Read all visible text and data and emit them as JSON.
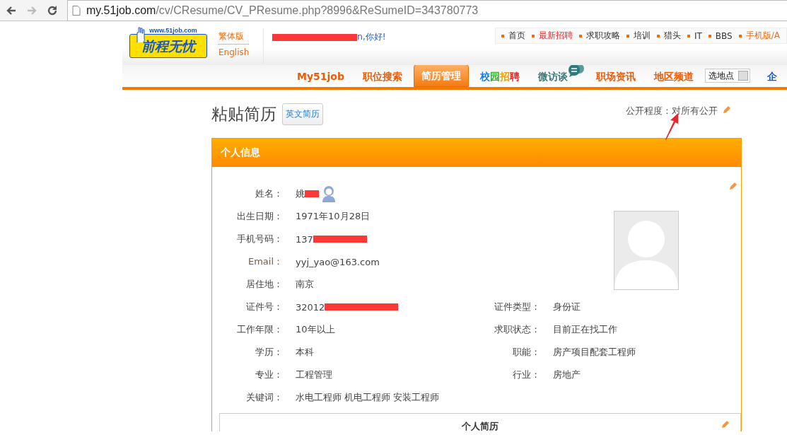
{
  "browser": {
    "url_host": "my.51job.com",
    "url_path": "/cv/CResume/CV_PResume.php?8996&ReSumeID=343780773"
  },
  "header": {
    "logo_url_text": "www.51job.com",
    "logo_text": "前程无忧",
    "lang_links": [
      "繁体版",
      "English"
    ],
    "greeting": {
      "redacted": true,
      "text": "n,你好!"
    },
    "top_links": [
      {
        "label": "首页",
        "kind": "normal"
      },
      {
        "label": "最新招聘",
        "kind": "hot"
      },
      {
        "label": "求职攻略",
        "kind": "normal"
      },
      {
        "label": "培训",
        "kind": "normal"
      },
      {
        "label": "猎头",
        "kind": "normal"
      },
      {
        "label": "IT",
        "kind": "normal"
      },
      {
        "label": "BBS",
        "kind": "normal"
      },
      {
        "label": "手机版/A",
        "kind": "mobile"
      }
    ]
  },
  "nav": [
    {
      "kind": "link",
      "label": "My51job",
      "selected": false
    },
    {
      "kind": "link",
      "label": "职位搜索",
      "selected": false
    },
    {
      "kind": "link",
      "label": "简历管理",
      "selected": true
    },
    {
      "kind": "multicolor",
      "segments": [
        {
          "text": "校",
          "color": "#1a7ee0"
        },
        {
          "text": "园",
          "color": "#3cab2f"
        },
        {
          "text": "招",
          "color": "#f5a000"
        },
        {
          "text": "聘",
          "color": "#e8272a"
        }
      ],
      "selected": false
    },
    {
      "kind": "chat",
      "label": "微访谈",
      "selected": false
    },
    {
      "kind": "link",
      "label": "职场资讯",
      "selected": false
    },
    {
      "kind": "link",
      "label": "地区频道",
      "selected": false
    },
    {
      "kind": "select",
      "value": "选地点"
    },
    {
      "kind": "cut",
      "label": "企"
    }
  ],
  "page": {
    "title": "粘贴简历",
    "english_button": "英文简历",
    "visibility_label": "公开程度：",
    "visibility_value": "对所有公开"
  },
  "section": {
    "title": "个人信息",
    "rows": [
      {
        "label": "姓名：",
        "value": "姚",
        "redacted": true,
        "avatar": true
      },
      {
        "label": "出生日期：",
        "value": "1971年10月28日"
      },
      {
        "label": "手机号码：",
        "value": "137",
        "redacted": true
      },
      {
        "label": "Email：",
        "value": "yyj_yao@163.com"
      },
      {
        "label": "居住地：",
        "value": "南京"
      },
      {
        "label": "证件号：",
        "value": "32012",
        "redacted": true,
        "right": {
          "label": "证件类型：",
          "value": "身份证"
        }
      },
      {
        "label": "工作年限：",
        "value": "10年以上",
        "right": {
          "label": "求职状态：",
          "value": "目前正在找工作"
        }
      },
      {
        "label": "学历：",
        "value": "本科",
        "right": {
          "label": "职能：",
          "value": "房产项目配套工程师"
        }
      },
      {
        "label": "专业：",
        "value": "工程管理",
        "right": {
          "label": "行业：",
          "value": "房地产"
        }
      },
      {
        "label": "关键词：",
        "value": "水电工程师 机电工程师 安装工程师"
      }
    ]
  },
  "subsection": {
    "title": "个人简历"
  }
}
